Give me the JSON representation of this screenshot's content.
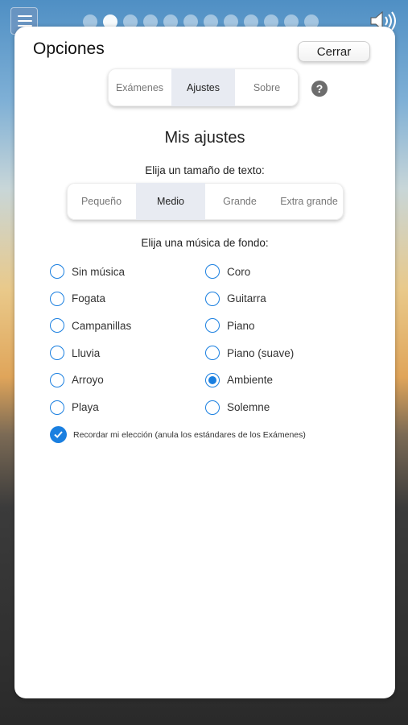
{
  "header": {
    "title": "Opciones",
    "close_label": "Cerrar",
    "page_dots": 12,
    "active_page": 2
  },
  "tabs": [
    {
      "label": "Exámenes",
      "selected": false
    },
    {
      "label": "Ajustes",
      "selected": true
    },
    {
      "label": "Sobre",
      "selected": false
    }
  ],
  "help_icon": "?",
  "settings": {
    "heading": "Mis ajustes",
    "text_size_prompt": "Elija un tamaño de texto:",
    "text_sizes": [
      {
        "label": "Pequeño",
        "selected": false
      },
      {
        "label": "Medio",
        "selected": true
      },
      {
        "label": "Grande",
        "selected": false
      },
      {
        "label": "Extra grande",
        "selected": false
      }
    ],
    "music_prompt": "Elija una música de fondo:",
    "music_left": [
      {
        "label": "Sin música",
        "selected": false
      },
      {
        "label": "Fogata",
        "selected": false
      },
      {
        "label": "Campanillas",
        "selected": false
      },
      {
        "label": "Lluvia",
        "selected": false
      },
      {
        "label": "Arroyo",
        "selected": false
      },
      {
        "label": "Playa",
        "selected": false
      }
    ],
    "music_right": [
      {
        "label": "Coro",
        "selected": false
      },
      {
        "label": "Guitarra",
        "selected": false
      },
      {
        "label": "Piano",
        "selected": false
      },
      {
        "label": "Piano (suave)",
        "selected": false
      },
      {
        "label": "Ambiente",
        "selected": true
      },
      {
        "label": "Solemne",
        "selected": false
      }
    ],
    "remember_label": "Recordar mi elección (anula los estándares de los Exámenes)",
    "remember_checked": true
  },
  "colors": {
    "accent": "#1a7fe0",
    "selected_segment": "#e8ebf2"
  }
}
